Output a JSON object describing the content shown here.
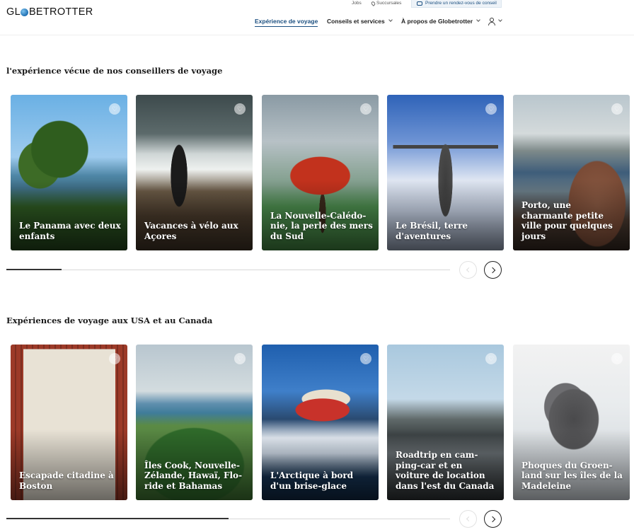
{
  "header": {
    "logo": {
      "part1": "GL",
      "part2": "BETROTTER"
    },
    "utility": {
      "jobs": "Jobs",
      "branches": "Succursales",
      "appointment": "Prendre un rendez-vous de conseil"
    },
    "nav": [
      {
        "label": "Expérience de voyage",
        "active": true
      },
      {
        "label": "Conseils et services",
        "dropdown": true
      },
      {
        "label": "À propos de Globetrotter",
        "dropdown": true
      }
    ],
    "icons": [
      "globe-icon",
      "pin-icon",
      "chat-icon",
      "user-icon",
      "chevron-down-icon"
    ]
  },
  "sections": [
    {
      "title": "l'expérience vécue de nos conseillers de voyage",
      "cards": [
        {
          "title": "Le Panama avec deux enfants"
        },
        {
          "title": "Vacances à vélo aux Açores"
        },
        {
          "title": "La Nouvelle-Calédo­nie, la perle des mers du Sud"
        },
        {
          "title": "Le Brésil, terre d'aventures"
        },
        {
          "title": "Porto, une charmante petite ville pour quelques jours"
        }
      ],
      "progress": 0.125
    },
    {
      "title": "Expériences de voyage aux USA et au Canada",
      "cards": [
        {
          "title": "Escapade citadine à Boston"
        },
        {
          "title": "Îles Cook, Nouvelle-Zélande, Hawaï, Flo­ride et Bahamas"
        },
        {
          "title": "L'Arctique à bord d'un brise-glace"
        },
        {
          "title": "Roadtrip en cam­ping-car et en voiture de location dans l'est du Canada"
        },
        {
          "title": "Phoques du Groen­land sur les îles de la Madeleine"
        }
      ],
      "progress": 0.5
    }
  ],
  "controls": {
    "prev_icon": "chevron-left-icon",
    "next_icon": "chevron-right-icon",
    "favorite_icon": "heart-icon",
    "heart_glyph": "♡"
  }
}
